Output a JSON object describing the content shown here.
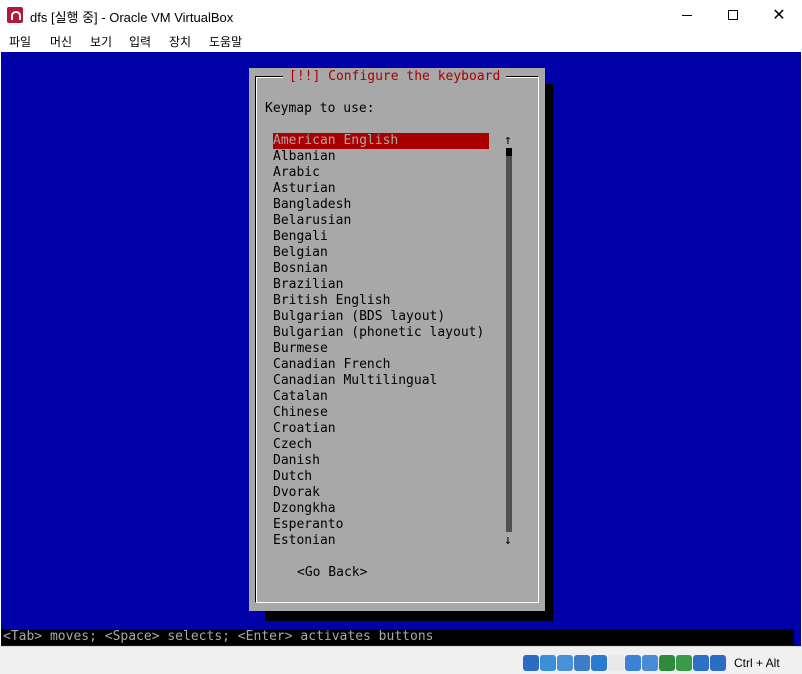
{
  "window": {
    "title": "dfs [실행 중] - Oracle VM VirtualBox",
    "close_glyph": "✕"
  },
  "menu": [
    "파일",
    "머신",
    "보기",
    "입력",
    "장치",
    "도움말"
  ],
  "dialog": {
    "title": "[!!] Configure the keyboard",
    "prompt": "Keymap to use:",
    "selected_index": 0,
    "keymaps": [
      "American English",
      "Albanian",
      "Arabic",
      "Asturian",
      "Bangladesh",
      "Belarusian",
      "Bengali",
      "Belgian",
      "Bosnian",
      "Brazilian",
      "British English",
      "Bulgarian (BDS layout)",
      "Bulgarian (phonetic layout)",
      "Burmese",
      "Canadian French",
      "Canadian Multilingual",
      "Catalan",
      "Chinese",
      "Croatian",
      "Czech",
      "Danish",
      "Dutch",
      "Dvorak",
      "Dzongkha",
      "Esperanto",
      "Estonian"
    ],
    "scroll_up_glyph": "↑",
    "scroll_down_glyph": "↓",
    "go_back_label": "<Go Back>"
  },
  "help_line": "<Tab> moves; <Space> selects; <Enter> activates buttons",
  "statusbar": {
    "icons": [
      {
        "name": "hard-disk-icon",
        "color": "#2b6cc4"
      },
      {
        "name": "optical-drive-icon",
        "color": "#3a8fd8"
      },
      {
        "name": "audio-icon",
        "color": "#4a90d9"
      },
      {
        "name": "network-icon",
        "color": "#3d7cc9"
      },
      {
        "name": "usb-icon",
        "color": "#2a7ad0"
      },
      {
        "name": "shared-folder-icon",
        "color": "#e8e8e8"
      },
      {
        "name": "display-icon",
        "color": "#3b82d6"
      },
      {
        "name": "video-capture-icon",
        "color": "#4a8bd6"
      },
      {
        "name": "cpu-icon",
        "color": "#2e8b3c"
      },
      {
        "name": "virtualization-icon",
        "color": "#3a9a4a"
      },
      {
        "name": "mouse-integration-icon",
        "color": "#2e6fc7"
      },
      {
        "name": "keyboard-capture-icon",
        "color": "#2b6cc4"
      }
    ],
    "host_key": "Ctrl + Alt"
  }
}
